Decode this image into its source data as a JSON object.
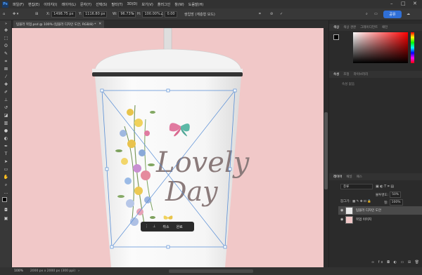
{
  "menu": [
    "파일(F)",
    "편집(E)",
    "이미지(I)",
    "레이어(L)",
    "문자(Y)",
    "선택(S)",
    "필터(T)",
    "3D(D)",
    "보기(V)",
    "플러그인",
    "창(W)",
    "도움말(H)"
  ],
  "app_logo": "Ps",
  "options": {
    "x_label": "X:",
    "x_value": "1498.75 px",
    "y_label": "Y:",
    "y_value": "1116.80 px",
    "w_label": "W:",
    "w_value": "96.73%",
    "h_label": "H:",
    "h_value": "100.00%",
    "angle_value": "0.00",
    "interp_value": "쌍입방 (계층형 모드)",
    "share_label": "공유"
  },
  "document_tab": "텀블러 목업.psd @ 100% (텀블러 디자인 도안, RGB/8) *",
  "artwork": {
    "line1": "Lovely",
    "line2": "Day"
  },
  "context_bar": {
    "cancel_label": "취소",
    "done_label": "완료"
  },
  "status": {
    "zoom": "100%",
    "doc_size": "2000 px x 2000 px (300 ppi)"
  },
  "panels": {
    "color_tabs": [
      "색상",
      "색상 견본",
      "그레이디언트",
      "패턴"
    ],
    "props_tabs": [
      "속성",
      "조정",
      "라이브러리"
    ],
    "props_placeholder": "속성 없음",
    "layers_tabs": [
      "레이어",
      "채널",
      "패스"
    ],
    "search_placeholder": "종류",
    "opacity_label": "불투명도:",
    "opacity_value": "50%",
    "fill_label": "칠:",
    "fill_value": "100%",
    "lock_label": "잠그기:",
    "layers": [
      {
        "name": "텀블러 디자인 도안"
      },
      {
        "name": "목업 이미지"
      }
    ]
  },
  "colors": {
    "canvas_bg": "#f1c8c8",
    "accent": "#2f6fd6",
    "text_brown": "#8a7a7a"
  }
}
